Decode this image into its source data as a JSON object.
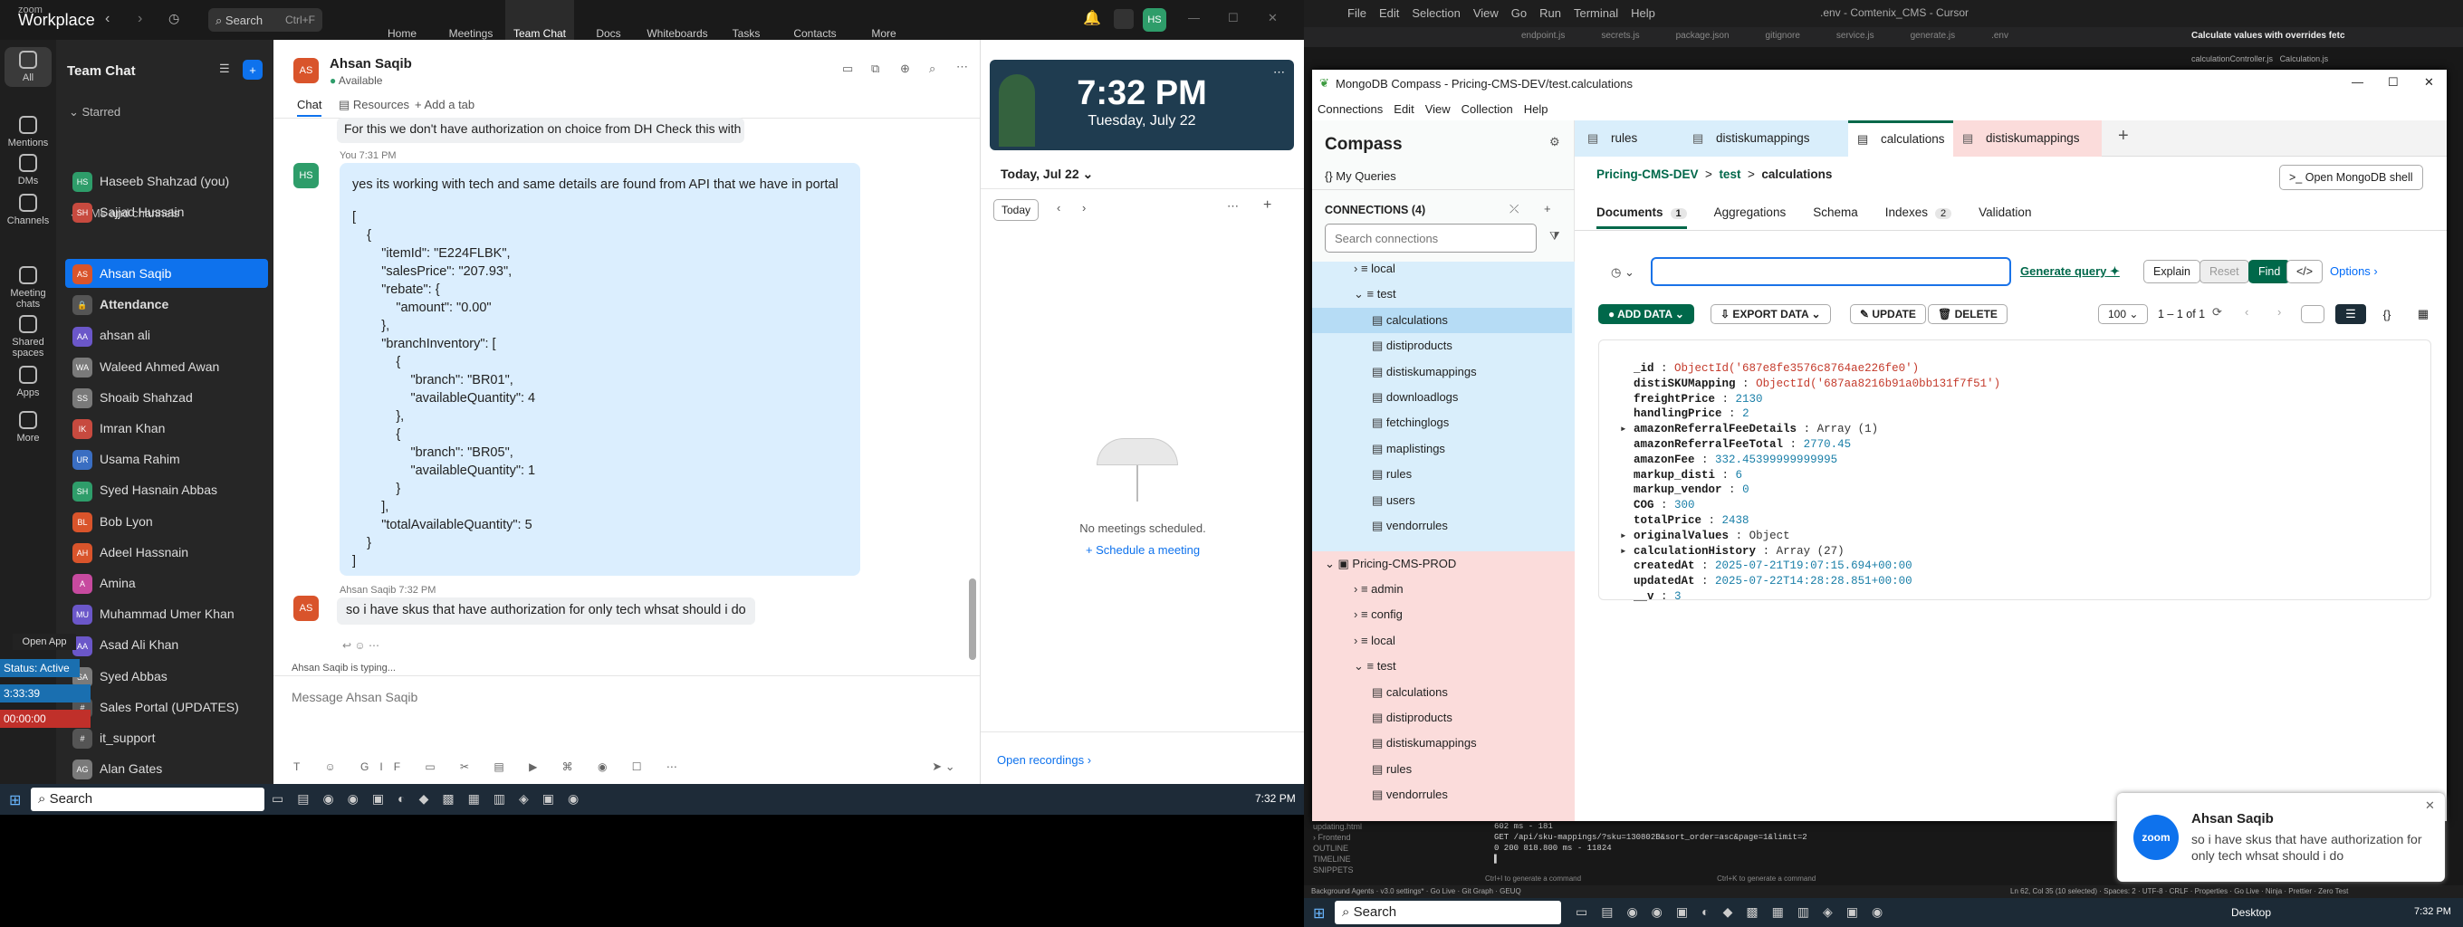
{
  "zoom": {
    "brand_top": "zoom",
    "brand": "Workplace",
    "search": "Search",
    "search_kbd": "Ctrl+F",
    "tabs": [
      "Home",
      "Meetings",
      "Team Chat",
      "Docs",
      "Whiteboards",
      "Tasks",
      "Contacts",
      "More"
    ],
    "user_avatar": "HS",
    "rail": [
      "All",
      "Mentions",
      "DMs",
      "Channels",
      "Meeting chats",
      "Shared spaces",
      "Apps",
      "More"
    ],
    "sidebar": {
      "title": "Team Chat",
      "starred": "Starred",
      "dms": "DMs and channels",
      "items": [
        {
          "n": "Haseeb Shahzad (you)",
          "i": "HS",
          "c": "#2e9d6a"
        },
        {
          "n": "Sajjad Hussain",
          "i": "SH",
          "c": "#c74a3f"
        },
        {
          "n": "Ahsan Saqib",
          "i": "AS",
          "c": "#d9542b"
        },
        {
          "n": "Attendance",
          "i": "🔒",
          "c": "#555"
        },
        {
          "n": "ahsan ali",
          "i": "AA",
          "c": "#6b57c9"
        },
        {
          "n": "Waleed Ahmed Awan",
          "i": "WA",
          "c": "#7a7a7a"
        },
        {
          "n": "Shoaib Shahzad",
          "i": "SS",
          "c": "#7a7a7a"
        },
        {
          "n": "Imran Khan",
          "i": "IK",
          "c": "#c74a3f"
        },
        {
          "n": "Usama Rahim",
          "i": "UR",
          "c": "#3a6ec2"
        },
        {
          "n": "Syed Hasnain Abbas",
          "i": "SH",
          "c": "#2e9d6a"
        },
        {
          "n": "Bob Lyon",
          "i": "BL",
          "c": "#d9542b"
        },
        {
          "n": "Adeel Hassnain",
          "i": "AH",
          "c": "#d9542b"
        },
        {
          "n": "Amina",
          "i": "A",
          "c": "#c74a9f"
        },
        {
          "n": "Muhammad Umer Khan",
          "i": "MU",
          "c": "#6b57c9"
        },
        {
          "n": "Asad Ali Khan",
          "i": "AA",
          "c": "#6b57c9"
        },
        {
          "n": "Syed Abbas",
          "i": "SA",
          "c": "#7a7a7a"
        },
        {
          "n": "Sales Portal (UPDATES)",
          "i": "#",
          "c": "#555"
        },
        {
          "n": "it_support",
          "i": "#",
          "c": "#555"
        },
        {
          "n": "Alan Gates",
          "i": "AG",
          "c": "#7a7a7a"
        }
      ]
    },
    "overlay": {
      "open_app": "Open App",
      "status": "Status: Active",
      "t1": "3:33:39",
      "t2": "00:00:00"
    },
    "chat": {
      "name": "Ahsan Saqib",
      "status": "Available",
      "tabs": [
        "Chat",
        "Resources",
        "+ Add a tab"
      ],
      "prev_msg": "For this we don't have authorization on choice from DH Check this with tech",
      "you_meta": "You 7:31 PM",
      "msg_line": "yes its working with tech and same details are found from API that we have in portal",
      "json_block": "[\n    {\n        \"itemId\": \"E224FLBK\",\n        \"salesPrice\": \"207.93\",\n        \"rebate\": {\n            \"amount\": \"0.00\"\n        },\n        \"branchInventory\": [\n            {\n                \"branch\": \"BR01\",\n                \"availableQuantity\": 4\n            },\n            {\n                \"branch\": \"BR05\",\n                \"availableQuantity\": 1\n            }\n        ],\n        \"totalAvailableQuantity\": 5\n    }\n]",
      "reply_meta": "Ahsan Saqib 7:32 PM",
      "reply": "so i have skus that have authorization for only tech whsat should i do",
      "typing": "Ahsan Saqib  is typing...",
      "input_placeholder": "Message Ahsan Saqib",
      "toolbar": [
        "T",
        "☺",
        "GIF"
      ]
    },
    "calendar": {
      "time": "7:32 PM",
      "date": "Tuesday, July 22",
      "today_hdr": "Today, Jul 22",
      "today_btn": "Today",
      "empty": "No meetings scheduled.",
      "schedule": "+ Schedule a meeting",
      "recordings": "Open recordings"
    }
  },
  "taskbar": {
    "search": "Search",
    "time": "7:32 PM",
    "search2": "Search",
    "desktop": "Desktop",
    "time2": "7:32 PM"
  },
  "cursor": {
    "menu": [
      "File",
      "Edit",
      "Selection",
      "View",
      "Go",
      "Run",
      "Terminal",
      "Help"
    ],
    "title": ".env - Comtenix_CMS - Cursor",
    "tabs": [
      "endpoint.js",
      "secrets.js",
      "package.json",
      "gitignore",
      "service.js",
      "generate.js",
      ".env"
    ],
    "chat_title": "Calculate values with overrides fetc",
    "chat_tabs": [
      "calculationController.js",
      "Calculation.js"
    ],
    "terminal": [
      "602 ms - 181",
      "GET /api/sku-mappings/?sku=130802B&sort_order=asc&page=1&limit=2",
      "0 200 818.800 ms - 11824"
    ],
    "side_bottom": [
      "updating.html",
      "Frontend",
      "OUTLINE",
      "TIMELINE",
      "SNIPPETS"
    ],
    "status": [
      "Background Agents",
      "v3.0 settings*",
      "Go Live",
      "Git Graph",
      "GEUQ",
      "Ctrl+I to generate a command",
      "Ctrl+K to generate a command",
      "Ln 62, Col 35 (10 selected)",
      "Spaces: 2",
      "UTF-8",
      "CRLF",
      "Properties",
      "Go Live",
      "Ninja",
      "Prettier",
      "Zero Test"
    ]
  },
  "compass": {
    "title": "MongoDB Compass - Pricing-CMS-DEV/test.calculations",
    "menu": [
      "Connections",
      "Edit",
      "View",
      "Collection",
      "Help"
    ],
    "app": "Compass",
    "my_queries": "My Queries",
    "connections_label": "CONNECTIONS (4)",
    "search_conn": "Search connections",
    "tree_dev": [
      "local",
      "test",
      "calculations",
      "distiproducts",
      "distiskumappings",
      "downloadlogs",
      "fetchinglogs",
      "maplistings",
      "rules",
      "users",
      "vendorrules"
    ],
    "prod_name": "Pricing-CMS-PROD",
    "tree_prod": [
      "admin",
      "config",
      "local",
      "test",
      "calculations",
      "distiproducts",
      "distiskumappings",
      "rules",
      "vendorrules"
    ],
    "tabs": [
      "rules",
      "distiskumappings",
      "calculations",
      "distiskumappings"
    ],
    "breadcrumb": [
      "Pricing-CMS-DEV",
      ">",
      "test",
      ">",
      "calculations"
    ],
    "shell": "Open MongoDB shell",
    "subtabs": [
      {
        "l": "Documents",
        "c": "1"
      },
      {
        "l": "Aggregations",
        "c": ""
      },
      {
        "l": "Schema",
        "c": ""
      },
      {
        "l": "Indexes",
        "c": "2"
      },
      {
        "l": "Validation",
        "c": ""
      }
    ],
    "gen_query": "Generate query",
    "explain": "Explain",
    "reset": "Reset",
    "find": "Find",
    "options": "Options",
    "add_data": "ADD DATA",
    "export": "EXPORT DATA",
    "update": "UPDATE",
    "delete": "DELETE",
    "page_size": "100",
    "range": "1 – 1 of 1",
    "doc": [
      {
        "k": "_id",
        "v": "ObjectId('687e8fe3576c8764ae226fe0')",
        "t": "s",
        "e": false
      },
      {
        "k": "distiSKUMapping",
        "v": "ObjectId('687aa8216b91a0bb131f7f51')",
        "t": "s",
        "e": false
      },
      {
        "k": "freightPrice",
        "v": "2130",
        "t": "n",
        "e": false
      },
      {
        "k": "handlingPrice",
        "v": "2",
        "t": "n",
        "e": false
      },
      {
        "k": "amazonReferralFeeDetails",
        "v": "Array (1)",
        "t": "o",
        "e": true
      },
      {
        "k": "amazonReferralFeeTotal",
        "v": "2770.45",
        "t": "n",
        "e": false
      },
      {
        "k": "amazonFee",
        "v": "332.45399999999995",
        "t": "n",
        "e": false
      },
      {
        "k": "markup_disti",
        "v": "6",
        "t": "n",
        "e": false
      },
      {
        "k": "markup_vendor",
        "v": "0",
        "t": "n",
        "e": false
      },
      {
        "k": "COG",
        "v": "300",
        "t": "n",
        "e": false
      },
      {
        "k": "totalPrice",
        "v": "2438",
        "t": "n",
        "e": false
      },
      {
        "k": "originalValues",
        "v": "Object",
        "t": "o",
        "e": true
      },
      {
        "k": "calculationHistory",
        "v": "Array (27)",
        "t": "o",
        "e": true
      },
      {
        "k": "createdAt",
        "v": "2025-07-21T19:07:15.694+00:00",
        "t": "n",
        "e": false
      },
      {
        "k": "updatedAt",
        "v": "2025-07-22T14:28:28.851+00:00",
        "t": "n",
        "e": false
      },
      {
        "k": "__v",
        "v": "3",
        "t": "n",
        "e": false
      }
    ]
  },
  "toast": {
    "app": "zoom",
    "name": "Ahsan Saqib",
    "msg": "so i have skus that have authorization for only tech whsat should i do"
  }
}
